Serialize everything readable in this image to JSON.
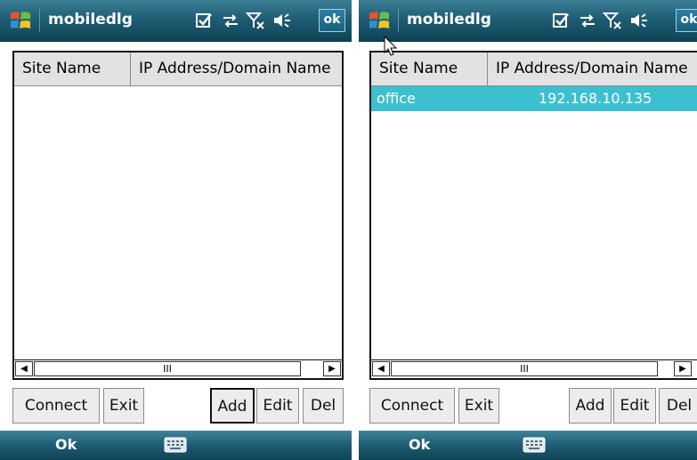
{
  "screens": [
    {
      "title": "mobiledlg",
      "status_icons": [
        "checkbox-icon",
        "sync-icon",
        "signal-off-icon",
        "speaker-icon"
      ],
      "ok_label": "ok",
      "columns": [
        "Site Name",
        "IP Address/Domain Name"
      ],
      "rows": [],
      "scroll_thumb": "III",
      "buttons": {
        "connect": "Connect",
        "exit": "Exit",
        "add": "Add",
        "edit": "Edit",
        "del": "Del"
      },
      "softkey_left": "Ok",
      "softkey_center_icon": "keyboard-icon"
    },
    {
      "title": "mobiledlg",
      "status_icons": [
        "checkbox-icon",
        "sync-icon",
        "signal-off-icon",
        "speaker-icon"
      ],
      "ok_label": "ok",
      "columns": [
        "Site Name",
        "IP Address/Domain Name"
      ],
      "rows": [
        {
          "site": "office",
          "address": "192.168.10.135",
          "selected": true
        }
      ],
      "scroll_thumb": "III",
      "buttons": {
        "connect": "Connect",
        "exit": "Exit",
        "add": "Add",
        "edit": "Edit",
        "del": "Del"
      },
      "softkey_left": "Ok",
      "softkey_center_icon": "keyboard-icon"
    }
  ],
  "colors": {
    "title_bar": "#1f5e74",
    "selection": "#3cc0cf",
    "ok_button": "#2d7fa3"
  }
}
